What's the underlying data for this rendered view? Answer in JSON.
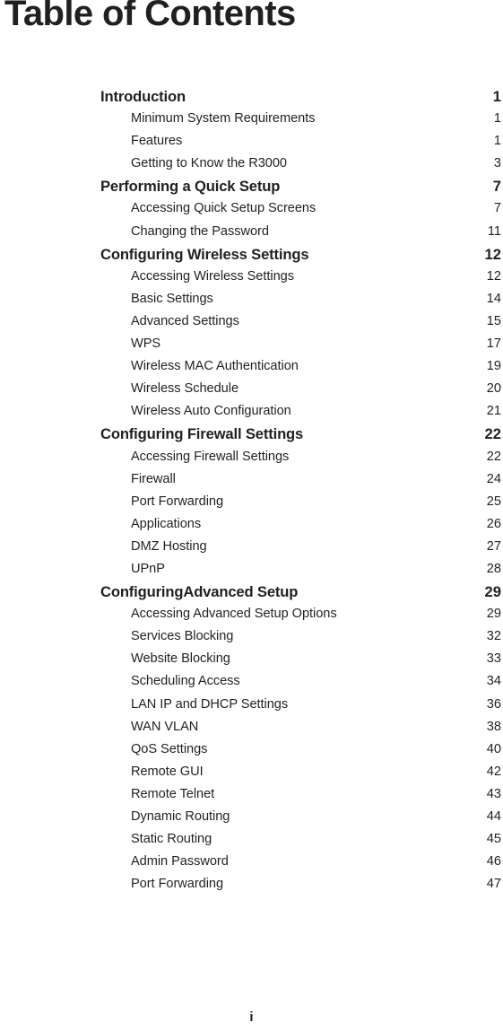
{
  "document": {
    "title": "Table of Contents",
    "folio": "i"
  },
  "toc": {
    "rows": [
      {
        "level": "section",
        "label": "Introduction",
        "page": "1"
      },
      {
        "level": "entry",
        "label": "Minimum System Requirements",
        "page": "1"
      },
      {
        "level": "entry",
        "label": "Features",
        "page": "1"
      },
      {
        "level": "entry",
        "label": "Getting to Know the R3000",
        "page": "3"
      },
      {
        "level": "section",
        "label": "Performing a Quick Setup",
        "page": "7"
      },
      {
        "level": "entry",
        "label": "Accessing Quick Setup Screens",
        "page": "7"
      },
      {
        "level": "entry",
        "label": "Changing the Password",
        "page": "11"
      },
      {
        "level": "section",
        "label": "Configuring Wireless Settings",
        "page": "12"
      },
      {
        "level": "entry",
        "label": "Accessing Wireless Settings",
        "page": "12"
      },
      {
        "level": "entry",
        "label": "Basic Settings",
        "page": "14"
      },
      {
        "level": "entry",
        "label": "Advanced Settings",
        "page": "15"
      },
      {
        "level": "entry",
        "label": "WPS",
        "page": "17"
      },
      {
        "level": "entry",
        "label": "Wireless MAC Authentication",
        "page": "19"
      },
      {
        "level": "entry",
        "label": "Wireless Schedule",
        "page": "20"
      },
      {
        "level": "entry",
        "label": "Wireless Auto Configuration",
        "page": "21"
      },
      {
        "level": "section",
        "label": "Configuring Firewall Settings",
        "page": "22"
      },
      {
        "level": "entry",
        "label": "Accessing Firewall Settings",
        "page": "22"
      },
      {
        "level": "entry",
        "label": "Firewall",
        "page": "24"
      },
      {
        "level": "entry",
        "label": "Port Forwarding",
        "page": "25"
      },
      {
        "level": "entry",
        "label": "Applications",
        "page": "26"
      },
      {
        "level": "entry",
        "label": "DMZ Hosting",
        "page": "27"
      },
      {
        "level": "entry",
        "label": "UPnP",
        "page": "28"
      },
      {
        "level": "section",
        "label": "ConfiguringAdvanced Setup",
        "page": "29"
      },
      {
        "level": "entry",
        "label": "Accessing Advanced Setup Options",
        "page": "29"
      },
      {
        "level": "entry",
        "label": "Services Blocking",
        "page": "32"
      },
      {
        "level": "entry",
        "label": "Website Blocking",
        "page": "33"
      },
      {
        "level": "entry",
        "label": "Scheduling Access",
        "page": "34"
      },
      {
        "level": "entry",
        "label": "LAN IP and DHCP Settings",
        "page": "36"
      },
      {
        "level": "entry",
        "label": "WAN VLAN",
        "page": "38"
      },
      {
        "level": "entry",
        "label": "QoS Settings",
        "page": "40"
      },
      {
        "level": "entry",
        "label": "Remote GUI",
        "page": "42"
      },
      {
        "level": "entry",
        "label": "Remote Telnet",
        "page": "43"
      },
      {
        "level": "entry",
        "label": "Dynamic Routing",
        "page": "44"
      },
      {
        "level": "entry",
        "label": "Static Routing",
        "page": "45"
      },
      {
        "level": "entry",
        "label": "Admin Password",
        "page": "46"
      },
      {
        "level": "entry",
        "label": "Port Forwarding",
        "page": "47"
      }
    ]
  }
}
